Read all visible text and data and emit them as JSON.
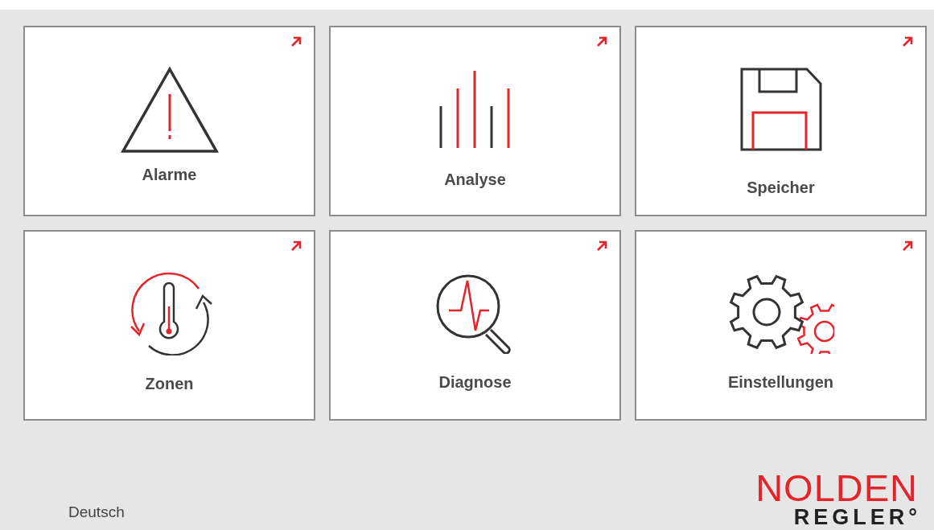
{
  "tiles": [
    {
      "label": "Alarme",
      "kind": "alarm"
    },
    {
      "label": "Analyse",
      "kind": "analysis"
    },
    {
      "label": "Speicher",
      "kind": "storage"
    },
    {
      "label": "Zonen",
      "kind": "zones"
    },
    {
      "label": "Diagnose",
      "kind": "diagnosis"
    },
    {
      "label": "Einstellungen",
      "kind": "settings"
    }
  ],
  "language": "Deutsch",
  "logo": {
    "brand": "NOLDEN",
    "sub": "REGLER°"
  }
}
